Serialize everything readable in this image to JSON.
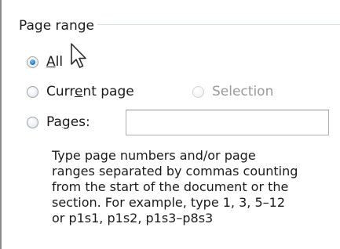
{
  "page_range": {
    "title": "Page range",
    "options": {
      "all": {
        "label_underline": "A",
        "label_rest": "ll",
        "checked": true
      },
      "current_page": {
        "label_before": "Curr",
        "label_underline": "e",
        "label_after": "nt page",
        "checked": false
      },
      "selection": {
        "label": "Selection",
        "enabled": false
      },
      "pages": {
        "label_before": "Pa",
        "label_underline": "g",
        "label_after": "es:",
        "checked": false
      }
    },
    "pages_input": {
      "value": ""
    },
    "help_lines": [
      "Type page numbers and/or page",
      "ranges separated by commas counting",
      "from the start of the document or the",
      "section. For example, type 1, 3, 5–12",
      "or p1s1, p1s2, p1s3–p8s3"
    ]
  },
  "icons": {
    "radio_checked": "radio-checked-icon",
    "radio_unchecked": "radio-unchecked-icon",
    "cursor": "mouse-pointer-icon"
  },
  "colors": {
    "radio_dot": "#1f6fb5",
    "disabled_text": "#9a9a9a",
    "group_line": "#d5dfe5"
  }
}
